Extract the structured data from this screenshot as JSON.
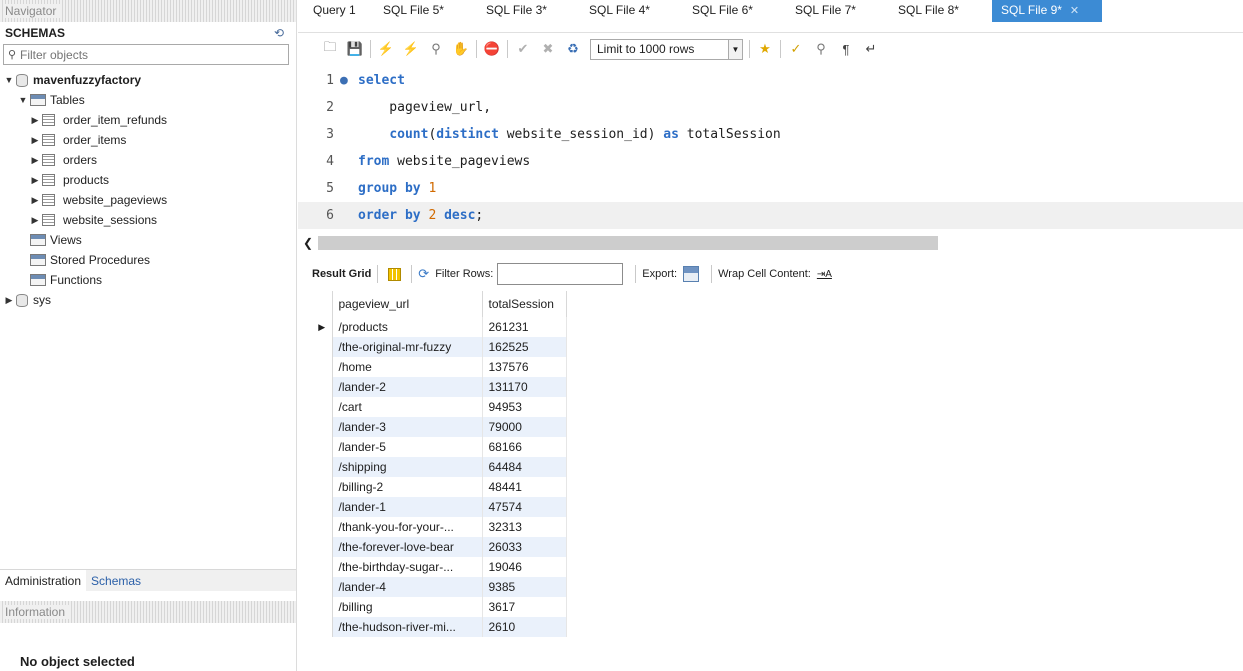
{
  "navigator": {
    "title": "Navigator",
    "schemas_label": "SCHEMAS",
    "filter_placeholder": "Filter objects",
    "schema_name": "mavenfuzzyfactory",
    "tables_label": "Tables",
    "tables": [
      "order_item_refunds",
      "order_items",
      "orders",
      "products",
      "website_pageviews",
      "website_sessions"
    ],
    "views_label": "Views",
    "stored_procedures_label": "Stored Procedures",
    "functions_label": "Functions",
    "sys_label": "sys",
    "bottom_tabs": [
      "Administration",
      "Schemas"
    ],
    "information_title": "Information",
    "no_object": "No object selected"
  },
  "tabs": [
    {
      "label": "Query 1"
    },
    {
      "label": "SQL File 5*"
    },
    {
      "label": "SQL File 3*"
    },
    {
      "label": "SQL File 4*"
    },
    {
      "label": "SQL File 6*"
    },
    {
      "label": "SQL File 7*"
    },
    {
      "label": "SQL File 8*"
    },
    {
      "label": "SQL File 9*",
      "active": true
    }
  ],
  "toolbar": {
    "limit_value": "Limit to 1000 rows"
  },
  "editor": {
    "line_numbers": [
      "1",
      "2",
      "3",
      "4",
      "5",
      "6"
    ]
  },
  "result_toolbar": {
    "result_grid": "Result Grid",
    "filter_rows": "Filter Rows:",
    "export": "Export:",
    "wrap": "Wrap Cell Content:"
  },
  "grid": {
    "columns": [
      "pageview_url",
      "totalSession"
    ],
    "rows": [
      [
        "/products",
        "261231"
      ],
      [
        "/the-original-mr-fuzzy",
        "162525"
      ],
      [
        "/home",
        "137576"
      ],
      [
        "/lander-2",
        "131170"
      ],
      [
        "/cart",
        "94953"
      ],
      [
        "/lander-3",
        "79000"
      ],
      [
        "/lander-5",
        "68166"
      ],
      [
        "/shipping",
        "64484"
      ],
      [
        "/billing-2",
        "48441"
      ],
      [
        "/lander-1",
        "47574"
      ],
      [
        "/thank-you-for-your-...",
        "32313"
      ],
      [
        "/the-forever-love-bear",
        "26033"
      ],
      [
        "/the-birthday-sugar-...",
        "19046"
      ],
      [
        "/lander-4",
        "9385"
      ],
      [
        "/billing",
        "3617"
      ],
      [
        "/the-hudson-river-mi...",
        "2610"
      ]
    ]
  },
  "colors": {
    "active_tab": "#3c8bd4",
    "keyword": "#2d6ec6",
    "number": "#d16a00",
    "alt_row": "#eaf1fb"
  }
}
